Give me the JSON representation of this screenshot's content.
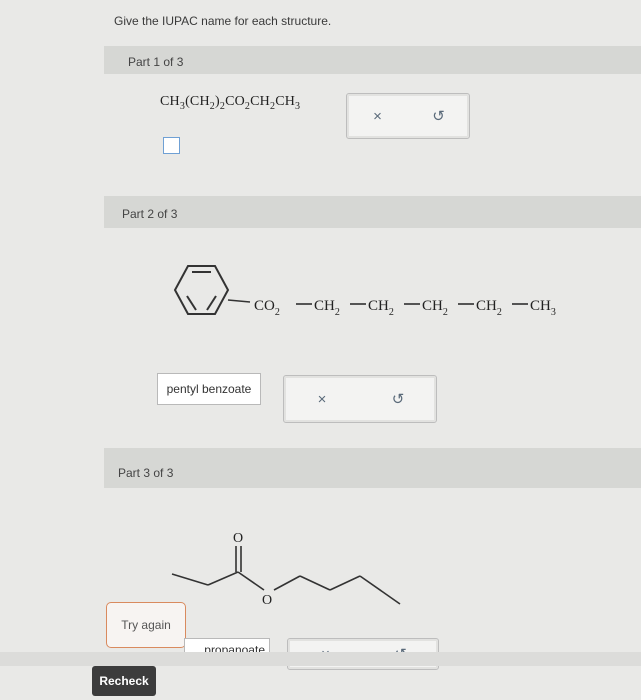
{
  "prompt": "Give the IUPAC name for each structure.",
  "part1": {
    "label": "Part 1 of 3",
    "formula": {
      "a": "CH",
      "a_sub": "3",
      "b": "(CH",
      "b_sub": "2",
      "c": ")",
      "c_sub": "2",
      "d": "CO",
      "d_sub": "2",
      "e": "CH",
      "e_sub": "2",
      "f": "CH",
      "f_sub": "3"
    },
    "clear_symbol": "×",
    "reset_symbol": "↺"
  },
  "part2": {
    "label": "Part 2 of 3",
    "chain": {
      "g1": "CO",
      "g1_sub": "2",
      "g2": "CH",
      "g2_sub": "2",
      "g3": "CH",
      "g3_sub": "2",
      "g4": "CH",
      "g4_sub": "2",
      "g5": "CH",
      "g5_sub": "2",
      "g6": "CH",
      "g6_sub": "3"
    },
    "answer": "pentyl benzoate",
    "clear_symbol": "×",
    "reset_symbol": "↺"
  },
  "part3": {
    "label": "Part 3 of 3",
    "atom_carbonyl_o": "O",
    "atom_ester_o": "O",
    "try_again": "Try again",
    "answer_partial": "propanoate",
    "clear_symbol": "×",
    "reset_symbol": "↺"
  },
  "recheck": "Recheck",
  "colors": {
    "accent": "#6fa0d4",
    "bar": "#d6d7d4",
    "try_again_border": "#d98a5e",
    "recheck_bg": "#3c3c3c"
  }
}
